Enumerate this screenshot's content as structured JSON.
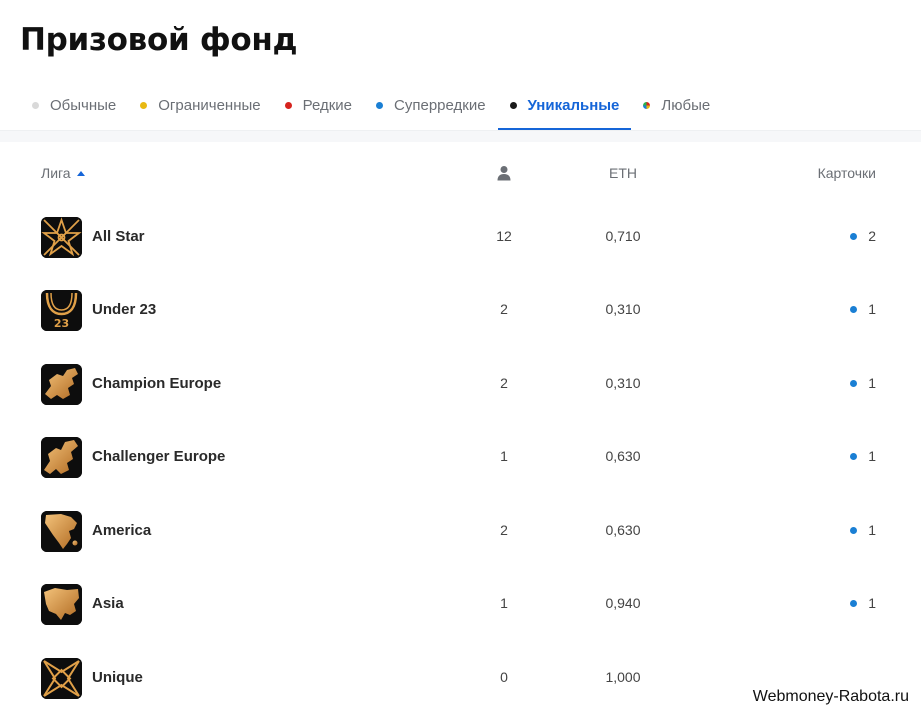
{
  "header": {
    "title": "Призовой фонд"
  },
  "tabs": [
    {
      "label": "Обычные",
      "dot_color": "#d9d9d9"
    },
    {
      "label": "Ограниченные",
      "dot_color": "#e8b912"
    },
    {
      "label": "Редкие",
      "dot_color": "#d6241e"
    },
    {
      "label": "Суперредкие",
      "dot_color": "#1a7fd4"
    },
    {
      "label": "Уникальные",
      "dot_color": "#1a1a1a",
      "active": true
    },
    {
      "label": "Любые",
      "dot_color": "multicolor"
    }
  ],
  "table": {
    "columns": {
      "league": "Лига",
      "players_icon": "person-icon",
      "eth": "ETH",
      "cards": "Карточки"
    },
    "sort": {
      "column": "league",
      "direction": "asc"
    },
    "rows": [
      {
        "league": "All Star",
        "icon": "all-star-logo",
        "players": "12",
        "eth": "0,710",
        "cards": "2"
      },
      {
        "league": "Under 23",
        "icon": "under-23-logo",
        "players": "2",
        "eth": "0,310",
        "cards": "1"
      },
      {
        "league": "Champion Europe",
        "icon": "champion-europe-logo",
        "players": "2",
        "eth": "0,310",
        "cards": "1"
      },
      {
        "league": "Challenger Europe",
        "icon": "challenger-europe-logo",
        "players": "1",
        "eth": "0,630",
        "cards": "1"
      },
      {
        "league": "America",
        "icon": "america-logo",
        "players": "2",
        "eth": "0,630",
        "cards": "1"
      },
      {
        "league": "Asia",
        "icon": "asia-logo",
        "players": "1",
        "eth": "0,940",
        "cards": "1"
      },
      {
        "league": "Unique",
        "icon": "unique-logo",
        "players": "0",
        "eth": "1,000",
        "cards": ""
      }
    ]
  },
  "colors": {
    "accent": "#1565d8",
    "card_dot": "#1a7fd4",
    "gold": "#e0a048"
  },
  "watermark": "Webmoney-Rabota.ru"
}
